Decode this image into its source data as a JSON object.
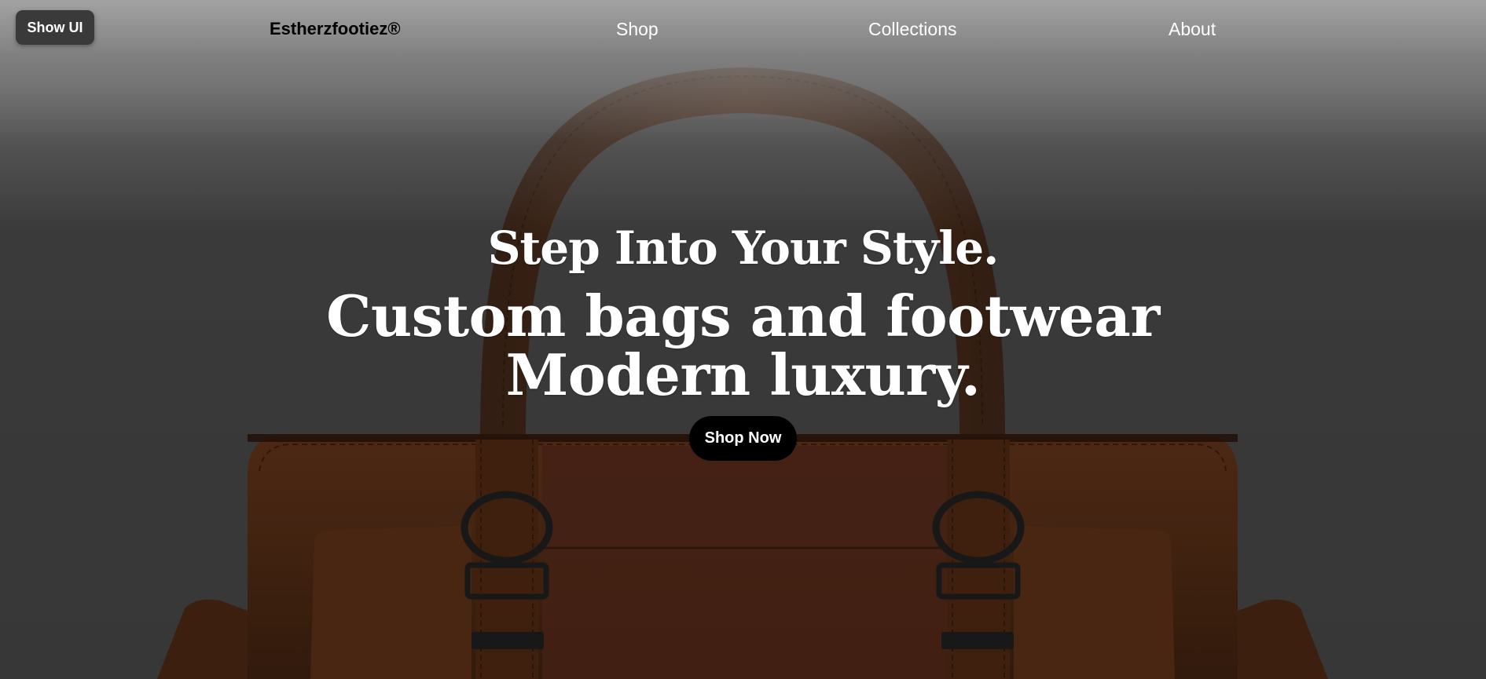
{
  "toggle": {
    "label": "Show UI"
  },
  "nav": {
    "brand": "Estherzfootiez®",
    "items": [
      {
        "label": "Shop"
      },
      {
        "label": "Collections"
      },
      {
        "label": "About"
      }
    ]
  },
  "hero": {
    "line1": "Step Into Your Style.",
    "line2": "Custom bags and footwear",
    "line3": "Modern luxury.",
    "cta_label": "Shop Now",
    "image_subject": "brown-leather-handbag"
  },
  "colors": {
    "leather": "#6b3a1e",
    "button": "#000000",
    "text": "#ffffff",
    "brand_text": "#000000"
  }
}
